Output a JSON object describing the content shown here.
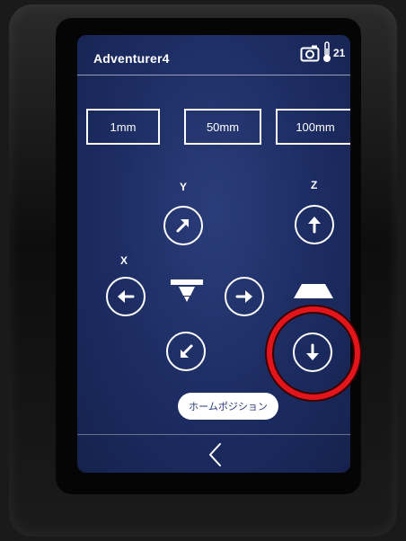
{
  "header": {
    "title": "Adventurer4",
    "camera_icon": "camera-icon",
    "temperature_icon": "thermometer-icon",
    "temperature": "21"
  },
  "steps": {
    "items": [
      {
        "label": "1mm"
      },
      {
        "label": "50mm"
      },
      {
        "label": "100mm"
      }
    ]
  },
  "axes": {
    "y_label": "Y",
    "z_label": "Z",
    "x_label": "X"
  },
  "controls": {
    "y_plus_icon": "arrow-up-right-icon",
    "z_up_icon": "arrow-up-icon",
    "x_minus_icon": "arrow-left-icon",
    "x_plus_icon": "arrow-right-icon",
    "y_minus_icon": "arrow-down-left-icon",
    "z_down_icon": "arrow-down-icon",
    "nozzle_icon": "nozzle-icon",
    "bed_icon": "build-plate-icon"
  },
  "home_button": {
    "label": "ホームポジション"
  },
  "footer": {
    "back_icon": "chevron-left-icon"
  },
  "colors": {
    "screen_bg": "#1c2c62",
    "highlight": "#e4141b",
    "text": "#ffffff"
  }
}
